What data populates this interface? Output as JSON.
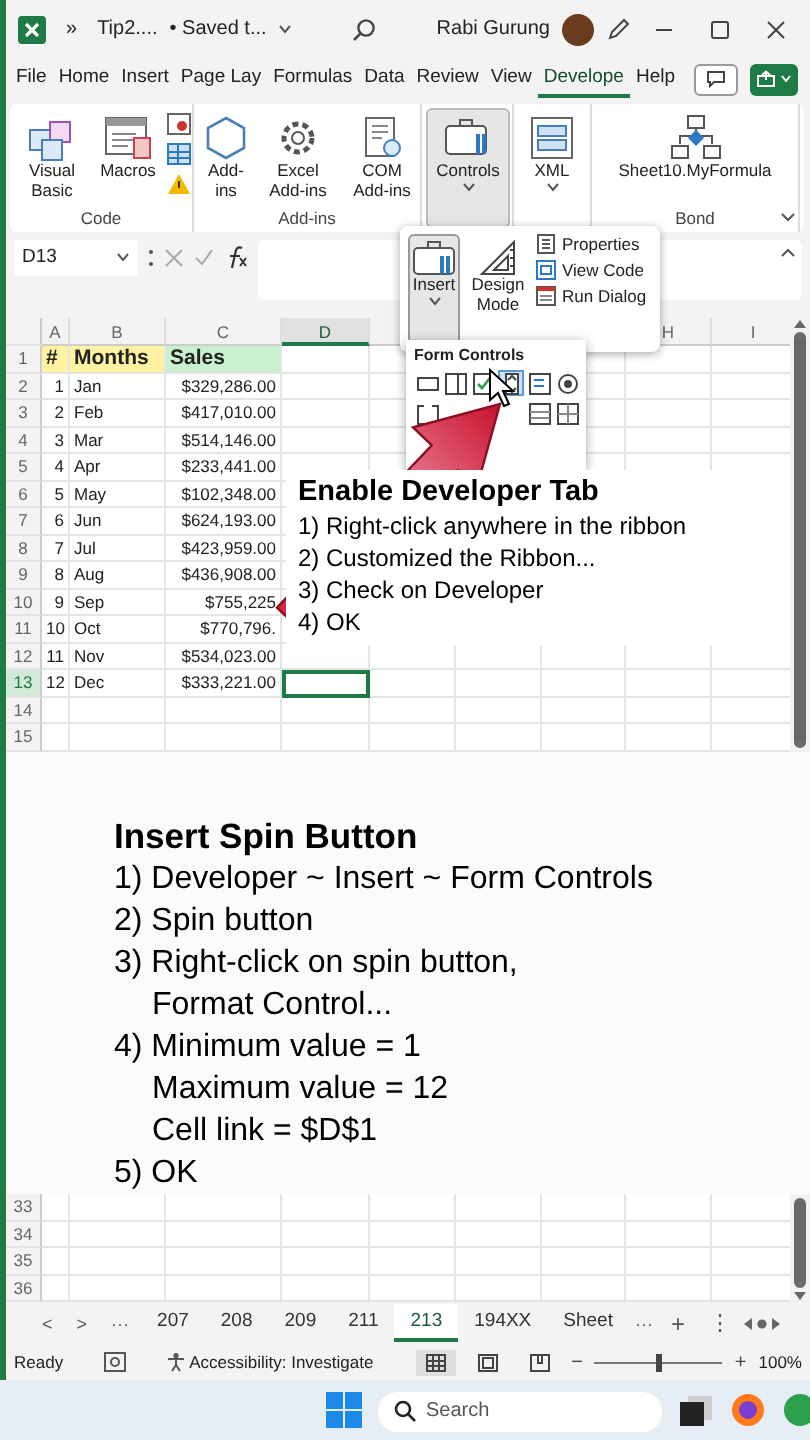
{
  "title_bar": {
    "quick_access": "»",
    "title": "Tip2....",
    "status": "• Saved t...",
    "user": "Rabi Gurung"
  },
  "ribbon_tabs": [
    {
      "label": "File",
      "selected": false
    },
    {
      "label": "Home",
      "selected": false
    },
    {
      "label": "Insert",
      "selected": false
    },
    {
      "label": "Page Lay",
      "selected": false
    },
    {
      "label": "Formulas",
      "selected": false
    },
    {
      "label": "Data",
      "selected": false
    },
    {
      "label": "Review",
      "selected": false
    },
    {
      "label": "View",
      "selected": false
    },
    {
      "label": "Develope",
      "selected": true
    },
    {
      "label": "Help",
      "selected": false
    }
  ],
  "ribbon_groups": [
    {
      "label": "Code",
      "buttons": [
        {
          "label": "Visual Basic",
          "pressed": false,
          "dropdown": false
        },
        {
          "label": "Macros",
          "pressed": false,
          "dropdown": false
        }
      ]
    },
    {
      "label": "Add-ins",
      "buttons": [
        {
          "label": "Add-ins",
          "pressed": false,
          "dropdown": false
        },
        {
          "label": "Excel Add-ins",
          "pressed": false,
          "dropdown": false
        },
        {
          "label": "COM Add-ins",
          "pressed": false,
          "dropdown": false
        }
      ]
    },
    {
      "buttons": [
        {
          "label": "Controls",
          "pressed": true,
          "dropdown": true
        }
      ]
    },
    {
      "buttons": [
        {
          "label": "XML",
          "pressed": false,
          "dropdown": true
        }
      ]
    },
    {
      "label": "Bond",
      "buttons": [
        {
          "label": "Sheet10.MyFormula",
          "pressed": false,
          "dropdown": false
        }
      ]
    }
  ],
  "formula_bar": {
    "name_box": "D13"
  },
  "controls_menu": {
    "buttons": [
      {
        "label": "Insert",
        "pressed": true
      },
      {
        "label": "Design Mode",
        "pressed": false
      }
    ],
    "commands": [
      "Properties",
      "View Code",
      "Run Dialog"
    ],
    "form_controls": {
      "title": "Form Controls",
      "items": [
        {
          "hovered": false
        },
        {
          "hovered": false
        },
        {
          "hovered": false
        },
        {
          "hovered": true
        },
        {
          "hovered": false
        },
        {
          "hovered": false
        },
        {
          "hovered": false
        },
        {
          "hovered": false
        },
        {
          "hovered": false
        }
      ]
    }
  },
  "sheet": {
    "columns": [
      {
        "label": "A",
        "selected": false
      },
      {
        "label": "B",
        "selected": false
      },
      {
        "label": "C",
        "selected": false
      },
      {
        "label": "D",
        "selected": true
      },
      {
        "label": "H",
        "selected": false
      },
      {
        "label": "I",
        "selected": false
      }
    ],
    "rows": [
      {
        "header": "1",
        "kind": "header",
        "selected": false,
        "cells": [
          "#",
          "Months",
          "Sales"
        ]
      },
      {
        "header": "2",
        "kind": "data",
        "selected": false,
        "cells": [
          "1",
          "Jan",
          "$329,286.00"
        ]
      },
      {
        "header": "3",
        "kind": "data",
        "selected": false,
        "cells": [
          "2",
          "Feb",
          "$417,010.00"
        ]
      },
      {
        "header": "4",
        "kind": "data",
        "selected": false,
        "cells": [
          "3",
          "Mar",
          "$514,146.00"
        ]
      },
      {
        "header": "5",
        "kind": "data",
        "selected": false,
        "cells": [
          "4",
          "Apr",
          "$233,441.00"
        ]
      },
      {
        "header": "6",
        "kind": "data",
        "selected": false,
        "cells": [
          "5",
          "May",
          "$102,348.00"
        ]
      },
      {
        "header": "7",
        "kind": "data",
        "selected": false,
        "cells": [
          "6",
          "Jun",
          "$624,193.00"
        ]
      },
      {
        "header": "8",
        "kind": "data",
        "selected": false,
        "cells": [
          "7",
          "Jul",
          "$423,959.00"
        ]
      },
      {
        "header": "9",
        "kind": "data",
        "selected": false,
        "cells": [
          "8",
          "Aug",
          "$436,908.00"
        ]
      },
      {
        "header": "10",
        "kind": "data",
        "selected": false,
        "cells": [
          "9",
          "Sep",
          "$755,225"
        ]
      },
      {
        "header": "11",
        "kind": "data",
        "selected": false,
        "cells": [
          "10",
          "Oct",
          "$770,796."
        ]
      },
      {
        "header": "12",
        "kind": "data",
        "selected": false,
        "cells": [
          "11",
          "Nov",
          "$534,023.00"
        ]
      },
      {
        "header": "13",
        "kind": "data",
        "selected": true,
        "cells": [
          "12",
          "Dec",
          "$333,221.00"
        ]
      },
      {
        "header": "14",
        "selected": false
      },
      {
        "header": "15",
        "selected": false
      }
    ],
    "lower_rows": [
      {
        "header": "33",
        "selected": false
      },
      {
        "header": "34",
        "selected": false
      },
      {
        "header": "35",
        "selected": false
      },
      {
        "header": "36",
        "selected": false
      }
    ]
  },
  "callouts": [
    {
      "kind": "floating",
      "title": "Enable Developer Tab",
      "lines": [
        {
          "text": "1) Right-click anywhere in the ribbon",
          "indent": false
        },
        {
          "text": "2) Customized the Ribbon...",
          "indent": false
        },
        {
          "text": "3) Check on Developer",
          "indent": false
        },
        {
          "text": "4) OK",
          "indent": false
        }
      ]
    },
    {
      "kind": "band",
      "title": "Insert Spin Button",
      "lines": [
        {
          "text": "1) Developer ~ Insert ~ Form Controls",
          "indent": false
        },
        {
          "text": "2) Spin button",
          "indent": false
        },
        {
          "text": "3) Right-click on spin button,",
          "indent": false
        },
        {
          "text": "Format Control...",
          "indent": true
        },
        {
          "text": "4) Minimum value = 1",
          "indent": false
        },
        {
          "text": "Maximum value = 12",
          "indent": true
        },
        {
          "text": "Cell link = $D$1",
          "indent": true
        },
        {
          "text": "5) OK",
          "indent": false
        }
      ]
    }
  ],
  "sheet_tabs": {
    "nav": [
      "<",
      ">",
      "···"
    ],
    "tabs": [
      {
        "label": "207",
        "selected": false
      },
      {
        "label": "208",
        "selected": false
      },
      {
        "label": "209",
        "selected": false
      },
      {
        "label": "211",
        "selected": false
      },
      {
        "label": "213",
        "selected": true
      },
      {
        "label": "194XX",
        "selected": false
      },
      {
        "label": "Sheet",
        "selected": false
      }
    ],
    "more": "···",
    "add": "+",
    "options": "⋮"
  },
  "status_bar": {
    "mode": "Ready",
    "accessibility": "Accessibility: Investigate",
    "views": [
      {
        "selected": true
      },
      {
        "selected": false
      },
      {
        "selected": false
      }
    ],
    "zoom_out": "−",
    "zoom_in": "+",
    "zoom": {
      "level": 0.5
    },
    "zoom_label": "100%"
  },
  "taskbar": {
    "search_placeholder": "Search"
  }
}
